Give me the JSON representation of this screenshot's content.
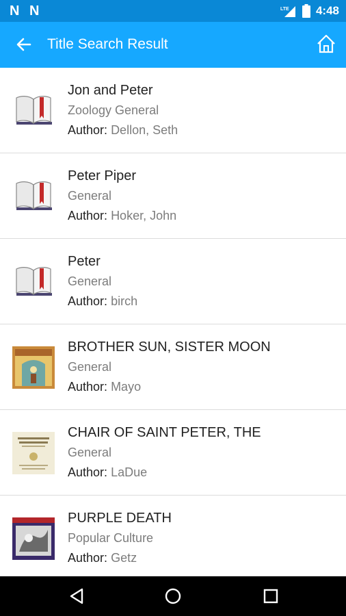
{
  "status_bar": {
    "time": "4:48",
    "lte": "LTE",
    "notif_icons": [
      "N",
      "N"
    ]
  },
  "app_bar": {
    "title": "Title Search Result"
  },
  "results": [
    {
      "title": "Jon and Peter",
      "category": "Zoology General",
      "author_label": "Author:",
      "author": "Dellon, Seth",
      "thumb": "book-icon"
    },
    {
      "title": "Peter Piper",
      "category": "General",
      "author_label": "Author:",
      "author": "Hoker, John",
      "thumb": "book-icon"
    },
    {
      "title": "Peter",
      "category": "General",
      "author_label": "Author:",
      "author": "birch",
      "thumb": "book-icon"
    },
    {
      "title": "BROTHER SUN, SISTER MOON",
      "category": "General",
      "author_label": "Author:",
      "author": "Mayo",
      "thumb": "cover-brother-sun"
    },
    {
      "title": "CHAIR OF SAINT PETER, THE",
      "category": "General",
      "author_label": "Author:",
      "author": "LaDue",
      "thumb": "cover-chair-of-saint-peter"
    },
    {
      "title": "PURPLE DEATH",
      "category": "Popular Culture",
      "author_label": "Author:",
      "author": "Getz",
      "thumb": "cover-purple-death"
    }
  ],
  "colors": {
    "status_bar": "#0a88d6",
    "app_bar": "#16a8ff",
    "nav_bar": "#000000"
  }
}
